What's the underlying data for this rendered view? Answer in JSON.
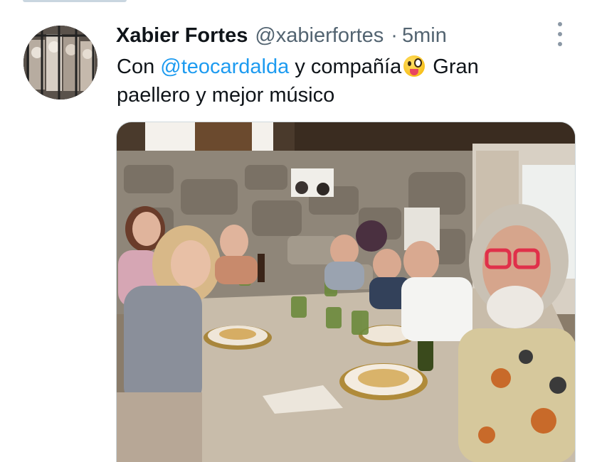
{
  "tweet": {
    "author_name": "Xabier Fortes",
    "author_handle": "@xabierfortes",
    "separator": "·",
    "time": "5min",
    "text_prefix": "Con ",
    "mention": "@teocardalda",
    "text_middle": " y compañía",
    "emoji": "zany-face-icon",
    "text_suffix": " Gran paellero y mejor músico"
  },
  "colors": {
    "link": "#1d9bf0",
    "secondary_text": "#536471",
    "primary_text": "#0f1419"
  }
}
